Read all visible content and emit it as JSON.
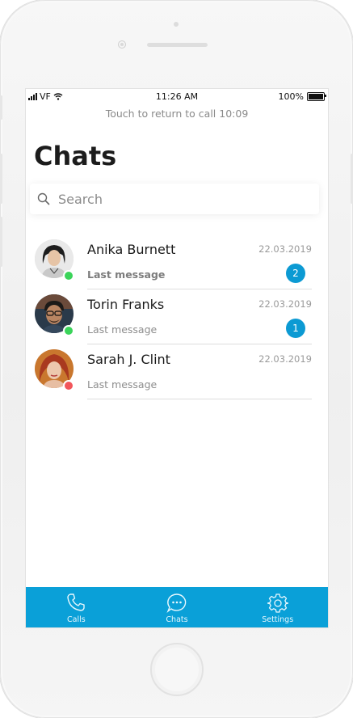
{
  "status_bar": {
    "carrier": "VF",
    "time": "11:26 AM",
    "battery": "100%"
  },
  "call_banner": "Touch to return to call 10:09",
  "page_title": "Chats",
  "search": {
    "placeholder": "Search",
    "value": ""
  },
  "chats": [
    {
      "name": "Anika Burnett",
      "date": "22.03.2019",
      "last_message": "Last message",
      "unread": "2",
      "presence": "online",
      "presence_color": "#3bd45a"
    },
    {
      "name": "Torin Franks",
      "date": "22.03.2019",
      "last_message": "Last message",
      "unread": "1",
      "presence": "online",
      "presence_color": "#3bd45a"
    },
    {
      "name": "Sarah J. Clint",
      "date": "22.03.2019",
      "last_message": "Last message",
      "unread": null,
      "presence": "offline",
      "presence_color": "#f2565b"
    }
  ],
  "tabs": [
    {
      "label": "Calls",
      "icon": "phone-icon"
    },
    {
      "label": "Chats",
      "icon": "chat-bubble-icon"
    },
    {
      "label": "Settings",
      "icon": "gear-icon"
    }
  ],
  "colors": {
    "accent": "#0aa0d8",
    "badge": "#0c9ad3"
  }
}
